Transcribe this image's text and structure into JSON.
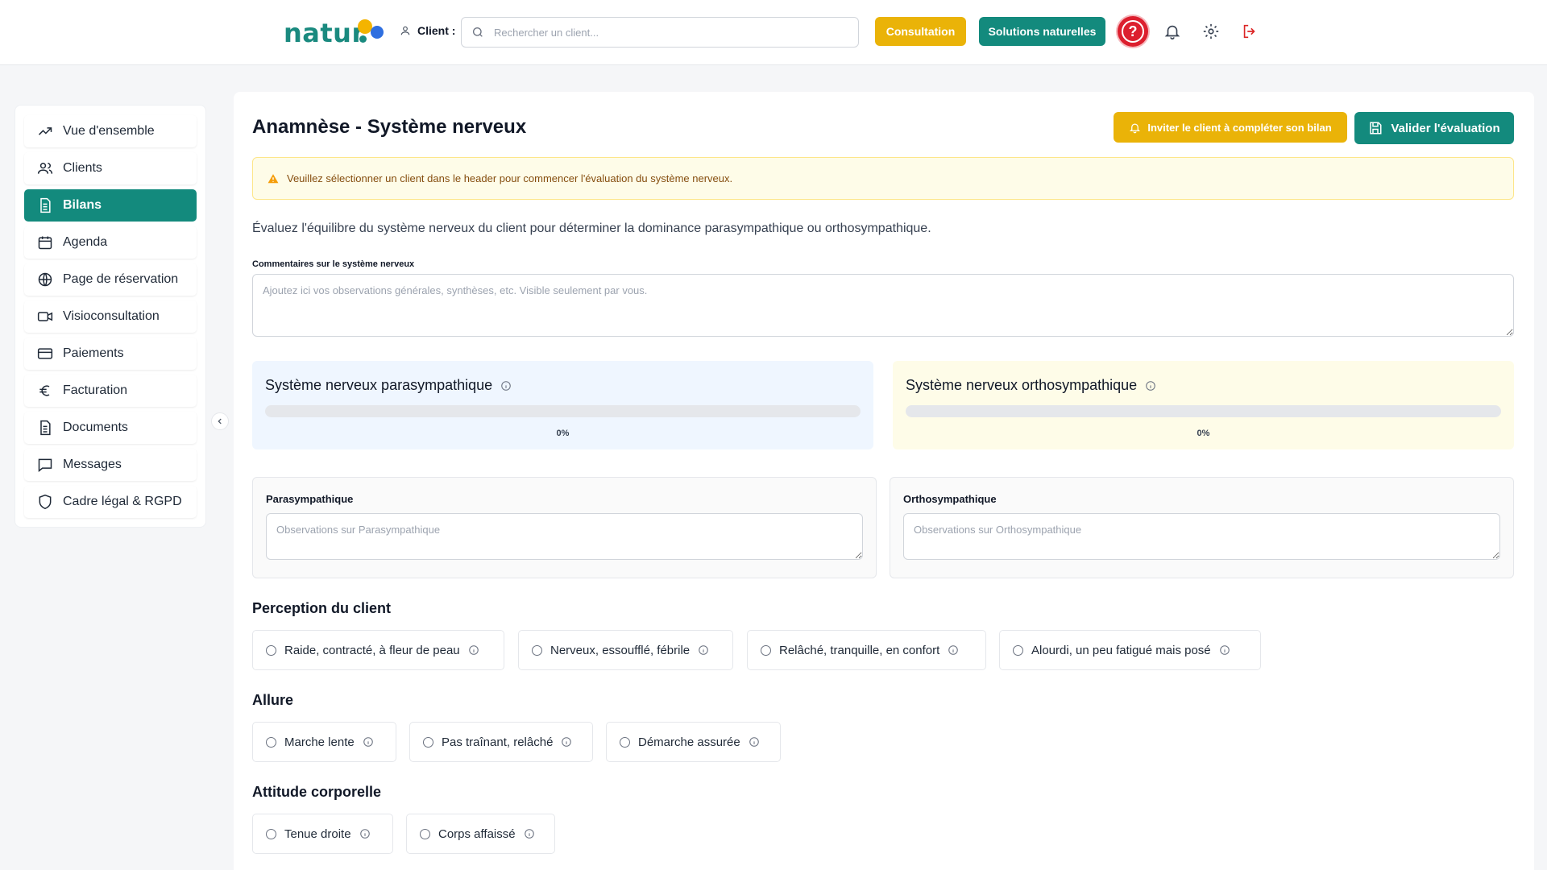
{
  "header": {
    "logo_text": "natur",
    "client_label": "Client :",
    "search_placeholder": "Rechercher un client...",
    "consultation_label": "Consultation",
    "solutions_label": "Solutions naturelles",
    "help_symbol": "?",
    "icons": [
      "user-icon",
      "search-icon",
      "help-icon",
      "bell-icon",
      "gear-icon",
      "logout-icon"
    ]
  },
  "sidebar": {
    "items": [
      {
        "label": "Vue d'ensemble",
        "icon": "trend-icon"
      },
      {
        "label": "Clients",
        "icon": "users-icon"
      },
      {
        "label": "Bilans",
        "icon": "document-icon",
        "active": true
      },
      {
        "label": "Agenda",
        "icon": "calendar-icon"
      },
      {
        "label": "Page de réservation",
        "icon": "globe-icon"
      },
      {
        "label": "Visioconsultation",
        "icon": "video-icon"
      },
      {
        "label": "Paiements",
        "icon": "card-icon"
      },
      {
        "label": "Facturation",
        "icon": "euro-icon"
      },
      {
        "label": "Documents",
        "icon": "document-icon"
      },
      {
        "label": "Messages",
        "icon": "chat-icon"
      },
      {
        "label": "Cadre légal & RGPD",
        "icon": "shield-icon"
      }
    ]
  },
  "main": {
    "title": "Anamnèse - Système nerveux",
    "invite_label": "Inviter le client à compléter son bilan",
    "validate_label": "Valider l'évaluation",
    "alert_text": "Veuillez sélectionner un client dans le header pour commencer l'évaluation du système nerveux.",
    "intro": "Évaluez l'équilibre du système nerveux du client pour déterminer la dominance parasympathique ou orthosympathique.",
    "comment_label": "Commentaires sur le système nerveux",
    "comment_placeholder": "Ajoutez ici vos observations générales, synthèses, etc. Visible seulement par vous.",
    "scores": {
      "para": {
        "title": "Système nerveux parasympathique",
        "value": 0,
        "pct_label": "0%"
      },
      "ortho": {
        "title": "Système nerveux orthosympathique",
        "value": 0,
        "pct_label": "0%"
      }
    },
    "observations": {
      "para": {
        "label": "Parasympathique",
        "placeholder": "Observations sur Parasympathique"
      },
      "ortho": {
        "label": "Orthosympathique",
        "placeholder": "Observations sur Orthosympathique"
      }
    },
    "sections": [
      {
        "title": "Perception du client",
        "options": [
          "Raide, contracté, à fleur de peau",
          "Nerveux, essoufflé, fébrile",
          "Relâché, tranquille, en confort",
          "Alourdi, un peu fatigué mais posé"
        ]
      },
      {
        "title": "Allure",
        "options": [
          "Marche lente",
          "Pas traînant, relâché",
          "Démarche assurée"
        ]
      },
      {
        "title": "Attitude corporelle",
        "options": [
          "Tenue droite",
          "Corps affaissé"
        ]
      }
    ]
  },
  "colors": {
    "primary": "#138a7d",
    "accent": "#eab308",
    "danger": "#dc1f2e",
    "para_bg": "#eff6ff",
    "ortho_bg": "#fefce8"
  }
}
